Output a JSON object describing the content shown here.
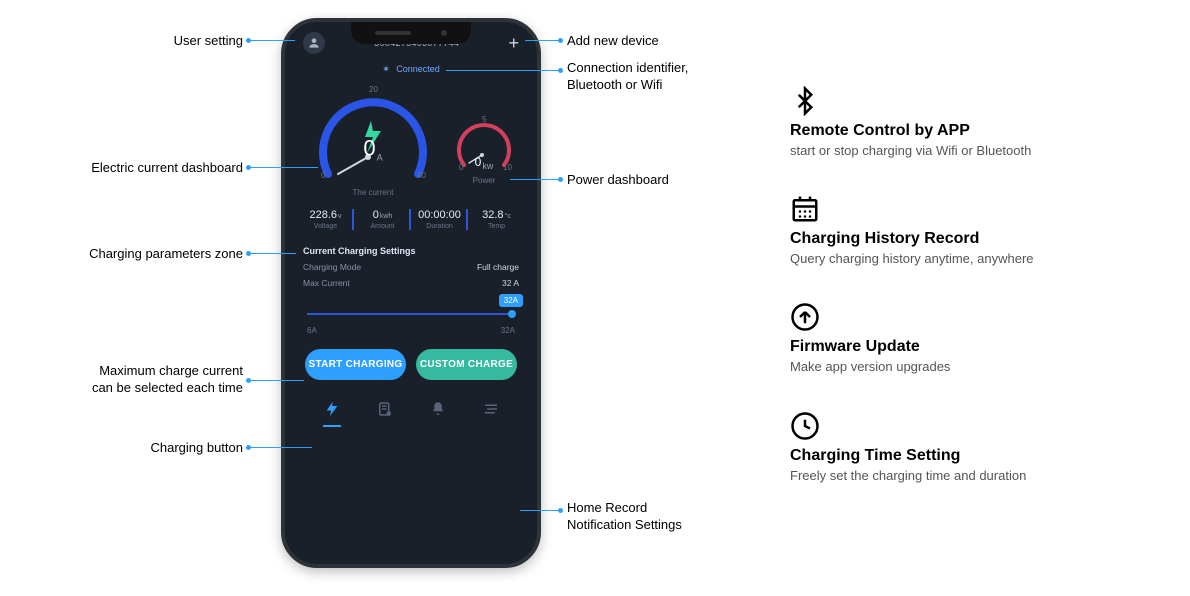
{
  "phone": {
    "device_id": "3004275406077744",
    "connection_status": "Connected",
    "gauges": {
      "current": {
        "value": "0",
        "unit": "A",
        "label": "The current",
        "tick_top": "20",
        "tick_left": "0",
        "tick_right": "40"
      },
      "power": {
        "value": "0",
        "unit": "kw",
        "label": "Power",
        "tick_top": "5",
        "tick_left": "0",
        "tick_right": "10"
      }
    },
    "params": {
      "voltage": {
        "value": "228.6",
        "unit": "v",
        "label": "Voltage"
      },
      "amount": {
        "value": "0",
        "unit": "kwh",
        "label": "Amount"
      },
      "duration": {
        "value": "00:00:00",
        "unit": "",
        "label": "Duration"
      },
      "temp": {
        "value": "32.8",
        "unit": "°c",
        "label": "Temp"
      }
    },
    "settings": {
      "title": "Current Charging Settings",
      "mode_label": "Charging Mode",
      "mode_value": "Full charge",
      "max_label": "Max Current",
      "max_value": "32 A",
      "slider_badge": "32A",
      "slider_min": "6A",
      "slider_max": "32A"
    },
    "buttons": {
      "start": "START CHARGING",
      "custom": "CUSTOM CHARGE"
    }
  },
  "callouts": {
    "user_setting": "User setting",
    "add_device": "Add new device",
    "connection": "Connection identifier,\nBluetooth or Wifi",
    "current_dash": "Electric current dashboard",
    "power_dash": "Power dashboard",
    "params_zone": "Charging parameters zone",
    "max_current": "Maximum charge current\ncan be selected each time",
    "charge_btn": "Charging button",
    "nav": "Home  Record\nNotification  Settings"
  },
  "features": [
    {
      "title": "Remote Control by APP",
      "desc": "start or stop charging via Wifi or Bluetooth"
    },
    {
      "title": "Charging History Record",
      "desc": "Query charging history anytime, anywhere"
    },
    {
      "title": "Firmware Update",
      "desc": "Make app version upgrades"
    },
    {
      "title": "Charging Time Setting",
      "desc": "Freely set the charging time and duration"
    }
  ]
}
